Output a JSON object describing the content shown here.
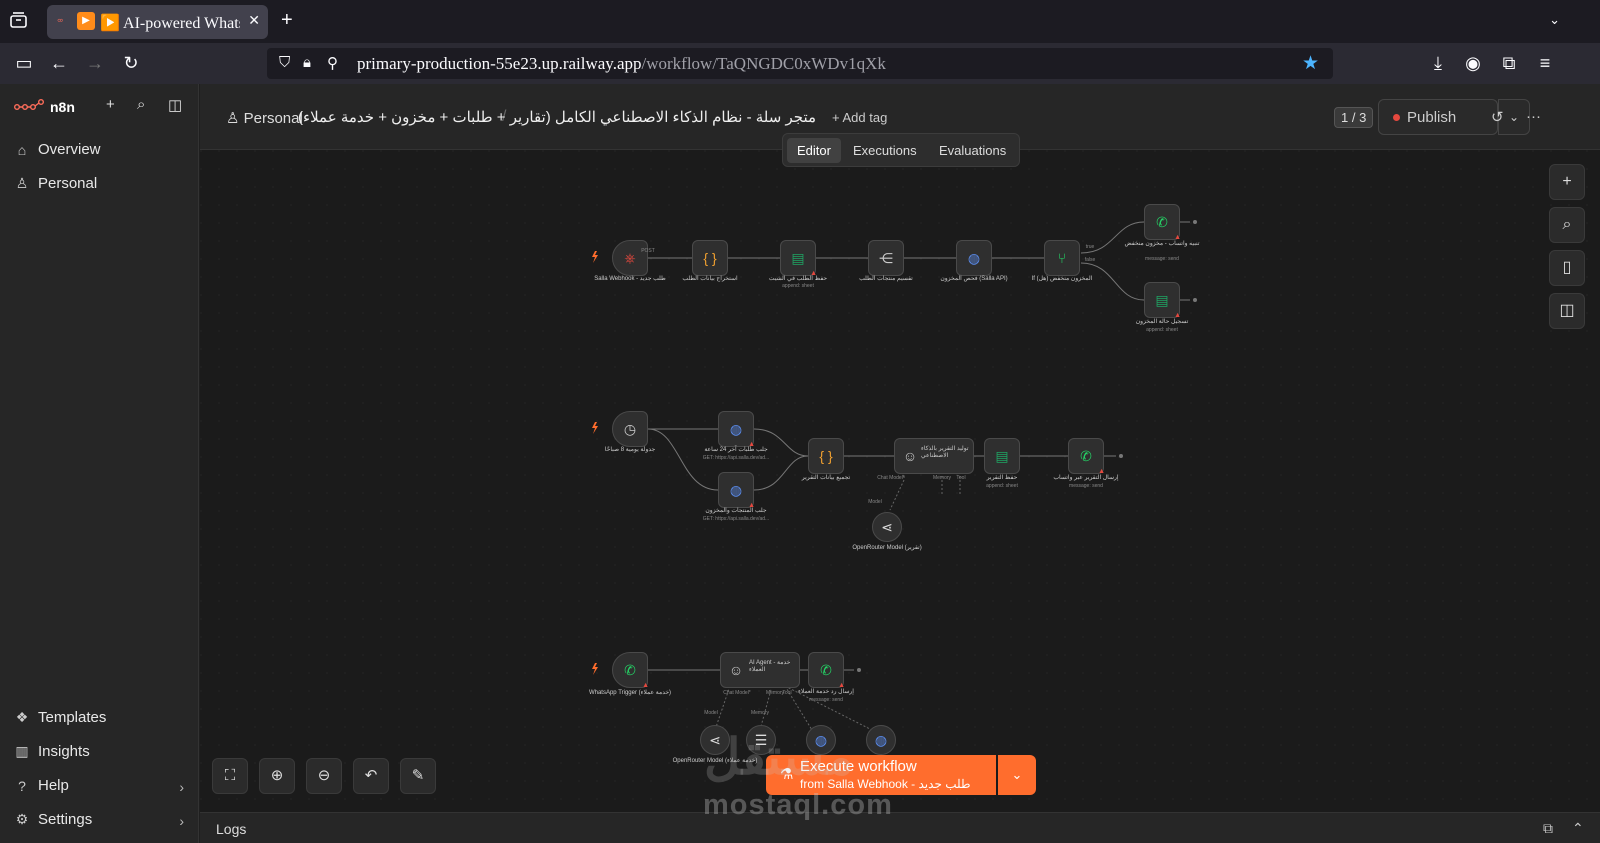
{
  "browser": {
    "tab_title": "▶️ AI-powered WhatsApp",
    "url_host": "primary-production-55e23.up.railway.app",
    "url_path": "/workflow/TaQNGDC0xWDv1qXk"
  },
  "sidebar": {
    "brand": "n8n",
    "items": [
      {
        "label": "Overview",
        "icon": "home-icon"
      },
      {
        "label": "Personal",
        "icon": "user-icon"
      }
    ],
    "bottom": [
      {
        "label": "Templates",
        "icon": "templates-icon"
      },
      {
        "label": "Insights",
        "icon": "insights-icon"
      },
      {
        "label": "Help",
        "icon": "help-icon"
      },
      {
        "label": "Settings",
        "icon": "settings-icon"
      }
    ]
  },
  "header": {
    "project": "Personal",
    "workflow_title": "متجر سلة - نظام الذكاء الاصطناعي الكامل (تقارير + طلبات + مخزون + خدمة عملاء)",
    "add_tag": "+ Add tag",
    "page_counter": "1 / 3",
    "publish": "Publish"
  },
  "view_tabs": [
    "Editor",
    "Executions",
    "Evaluations"
  ],
  "nodes": {
    "n1": "Salla Webhook - طلب جديد",
    "n2": "استخراج بيانات الطلب",
    "n3": "حفظ الطلب في الشيت",
    "n3s": "append: sheet",
    "n4": "تقسيم منتجات الطلب",
    "n5": "فحص المخزون (Salla API)",
    "n6": "If (هل) المخزون منخفض",
    "n7": "تنبيه واتساب - مخزون منخفض",
    "n7s": "message: send",
    "n8": "تسجيل حالة المخزون",
    "n8s": "append: sheet",
    "n9": "جدولة يومية 8 صباحًا",
    "n10": "جلب طلبات آخر 24 ساعة",
    "n10s": "GET: https://api.salla.dev/ad...",
    "n11": "جلب المنتجات والمخزون",
    "n11s": "GET: https://api.salla.dev/ad...",
    "n12": "تجميع بيانات التقرير",
    "n13": "توليد التقرير بالذكاء الاصطناعي",
    "n14": "حفظ التقرير",
    "n14s": "append: sheet",
    "n15": "إرسال التقرير عبر واتساب",
    "n15s": "message: send",
    "n16": "OpenRouter Model (تقرير)",
    "n17": "WhatsApp Trigger (خدمة عملاء)",
    "n18": "AI Agent - خدمة العملاء",
    "n19": "إرسال رد خدمة العملاء",
    "n19s": "message: send",
    "n20": "OpenRouter Model (خدمة عملاء)",
    "port_post": "POST",
    "port_true": "true",
    "port_false": "false",
    "port_model": "Model",
    "port_chat": "Chat Model*",
    "port_memory": "Memory",
    "port_tool": "Tool"
  },
  "execute": {
    "label": "Execute workflow",
    "sub": "from Salla Webhook - طلب جديد"
  },
  "logs": "Logs",
  "watermark": "mostaql.com",
  "watermark_ar": "مستقل",
  "colors": {
    "accent": "#ff6d2d",
    "brand": "#ff6d5a",
    "whatsapp": "#25d366",
    "sheets": "#1fa463",
    "http": "#5b8def"
  }
}
